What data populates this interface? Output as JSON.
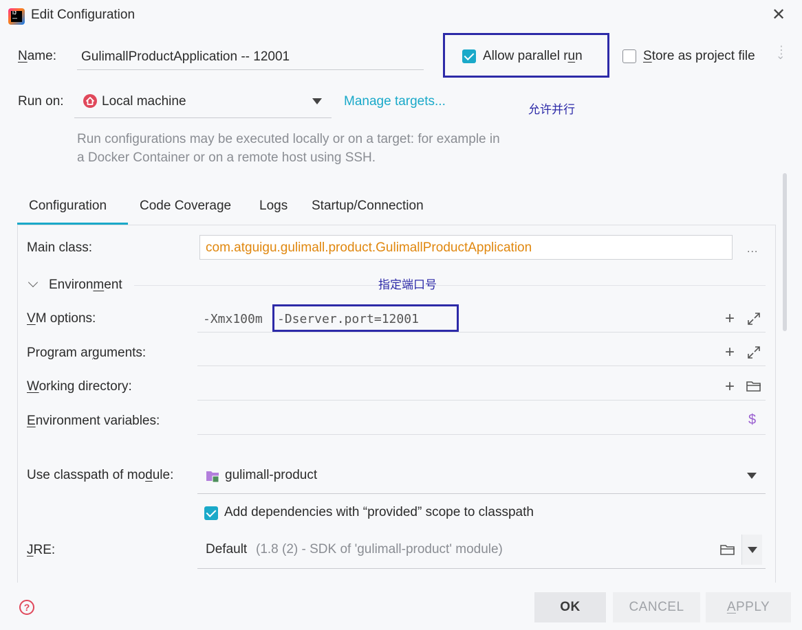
{
  "window": {
    "title": "Edit Configuration",
    "close_glyph": "✕"
  },
  "name": {
    "label_first": "N",
    "label_rest": "ame:",
    "value": "GulimallProductApplication -- 12001"
  },
  "parallel": {
    "label_pre": "Allow parallel r",
    "label_u": "u",
    "label_post": "n",
    "checked": true
  },
  "store": {
    "label_first": "S",
    "label_rest": "tore as project file",
    "checked": false
  },
  "run_on": {
    "label": "Run on:",
    "value": "Local machine",
    "manage_link": "Manage targets...",
    "help": "Run configurations may be executed locally or on a target: for example in a Docker Container or on a remote host using SSH."
  },
  "annotations": {
    "parallel": "允许并行",
    "port": "指定端口号"
  },
  "tabs": [
    {
      "label": "Configuration",
      "active": true
    },
    {
      "label": "Code Coverage",
      "active": false
    },
    {
      "label": "Logs",
      "active": false
    },
    {
      "label": "Startup/Connection",
      "active": false
    }
  ],
  "main_class": {
    "label": "Main class:",
    "value": "com.atguigu.gulimall.product.GulimallProductApplication",
    "more": "..."
  },
  "environment": {
    "label_pre": "Environ",
    "label_u": "m",
    "label_post": "ent"
  },
  "vm_options": {
    "label_first": "V",
    "label_rest": "M options:",
    "prefix": "-Xmx100m",
    "port_arg": "-Dserver.port=12001"
  },
  "program_args": {
    "label_pre": "Program ar",
    "label_u": "g",
    "label_post": "uments:"
  },
  "working_dir": {
    "label_first": "W",
    "label_rest": "orking directory:"
  },
  "env_vars": {
    "label_first": "E",
    "label_rest": "nvironment variables:",
    "dollar": "$"
  },
  "classpath": {
    "label_pre": "Use classpath of mo",
    "label_u": "d",
    "label_post": "ule:",
    "value": "gulimall-product"
  },
  "provided": {
    "label": "Add dependencies with “provided” scope to classpath",
    "checked": true
  },
  "jre": {
    "label_first": "J",
    "label_rest": "RE:",
    "value_default": "Default",
    "value_detail": "(1.8 (2) - SDK of 'gulimall-product' module)"
  },
  "buttons": {
    "help": "?",
    "ok": "OK",
    "cancel": "CANCEL",
    "apply_first": "A",
    "apply_rest": "PPLY"
  },
  "colors": {
    "accent": "#1aa9c9",
    "annotation": "#2d2aa8",
    "main_class_text": "#e0870e",
    "help_text": "#8a8d93"
  },
  "icons": [
    "app-logo-icon",
    "close-icon",
    "checkbox-icon",
    "more-options-icon",
    "home-icon",
    "dropdown-arrow-icon",
    "chevron-down-icon",
    "plus-icon",
    "expand-icon",
    "folder-icon",
    "dollar-icon",
    "module-icon",
    "help-icon"
  ]
}
